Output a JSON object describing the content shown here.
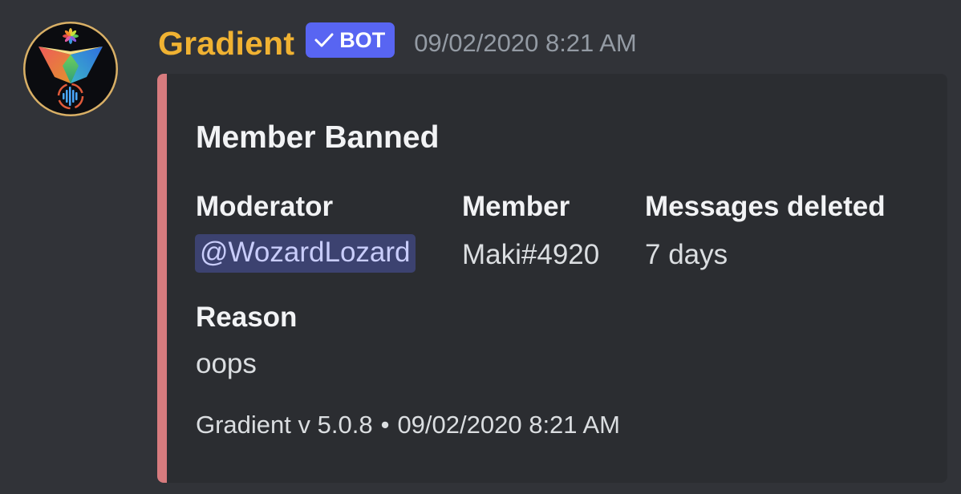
{
  "message": {
    "author": {
      "name": "Gradient",
      "name_color": "#f0b232",
      "avatar_icon": "gradient-logo-icon",
      "bot_tag": {
        "label": "BOT",
        "verified_icon": "checkmark-icon",
        "color": "#5865f2"
      }
    },
    "timestamp": "09/02/2020 8:21 AM",
    "embed": {
      "accent_color": "#d77b7e",
      "title": "Member Banned",
      "fields": [
        {
          "name": "Moderator",
          "value": "@WozardLozard",
          "type": "mention"
        },
        {
          "name": "Member",
          "value": "Maki#4920"
        },
        {
          "name": "Messages deleted",
          "value": "7 days"
        },
        {
          "name": "Reason",
          "value": "oops"
        }
      ],
      "footer": {
        "text": "Gradient v 5.0.8",
        "separator": "•",
        "timestamp": "09/02/2020 8:21 AM"
      }
    }
  }
}
